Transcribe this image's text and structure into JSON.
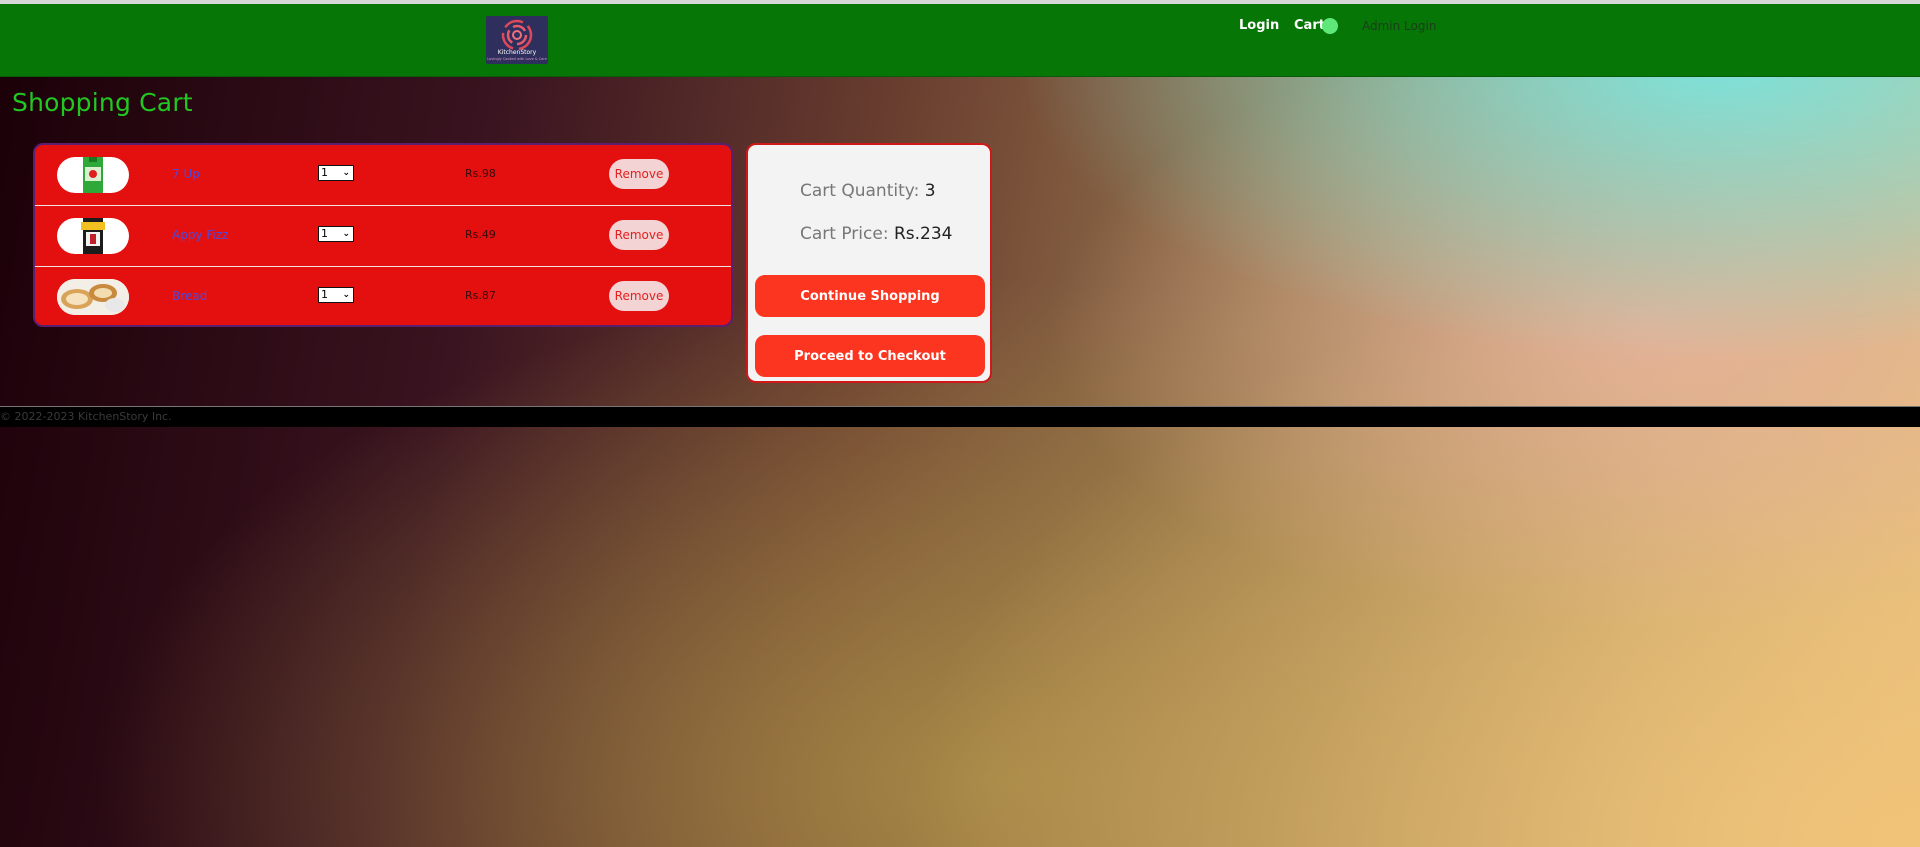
{
  "navbar": {
    "logo_text": "KitchenStory",
    "logo_tagline": "Lovingly Cooked with Love & Care",
    "login_label": "Login",
    "cart_label": "Cart",
    "admin_label": "Admin Login"
  },
  "page_title": "Shopping Cart",
  "cart": {
    "items": [
      {
        "name": "7 Up",
        "qty": "1",
        "price": "Rs.98",
        "remove_label": "Remove"
      },
      {
        "name": "Appy Fizz",
        "qty": "1",
        "price": "Rs.49",
        "remove_label": "Remove"
      },
      {
        "name": "Bread",
        "qty": "1",
        "price": "Rs.87",
        "remove_label": "Remove"
      }
    ]
  },
  "summary": {
    "quantity_label": "Cart Quantity: ",
    "quantity_value": "3",
    "price_label": "Cart Price: ",
    "price_value": "Rs.234",
    "continue_label": "Continue Shopping",
    "checkout_label": "Proceed to Checkout"
  },
  "footer": {
    "copyright": "© 2022-2023 KitchenStory Inc."
  },
  "colors": {
    "navbar": "#067606",
    "title": "#22c822",
    "cart_panel": "#e41010",
    "action_button": "#fb3520",
    "cart_indicator": "#5fe87a"
  }
}
